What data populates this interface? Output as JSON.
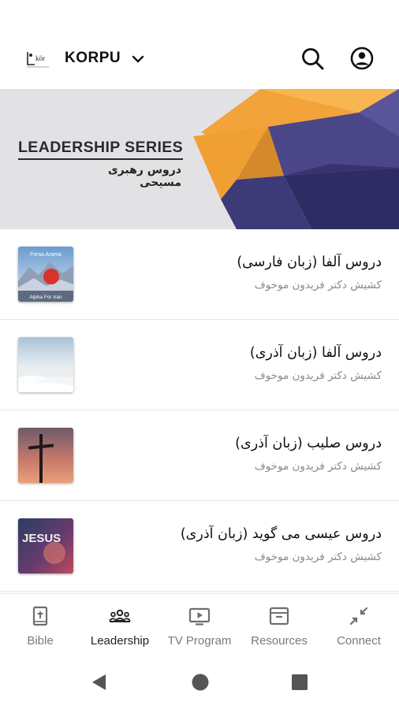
{
  "header": {
    "logo_name": "church-logo",
    "brand": "KORPU"
  },
  "banner": {
    "title": "LEADERSHIP SERIES",
    "subtitle": "دروس رهبری مسیحی",
    "colors": {
      "background": "#e2e2e4",
      "orange": "#f2a33a",
      "indigo": "#3e3a78"
    }
  },
  "lessons": [
    {
      "title": "دروس آلفا (زبان فارسی)",
      "author": "کشیش دکتر فریدون موخوف",
      "thumb_text_1": "Forsa Arama",
      "thumb_text_2": "Alpha For Iran"
    },
    {
      "title": "دروس آلفا (زبان آذری)",
      "author": "کشیش دکتر فریدون موخوف"
    },
    {
      "title": "دروس صلیب (زبان آذری)",
      "author": "کشیش دکتر فریدون موخوف"
    },
    {
      "title": "دروس عیسی می گوید (زبان آذری)",
      "author": "کشیش دکتر فریدون موخوف",
      "thumb_text_1": "JESUS"
    }
  ],
  "tabs": [
    {
      "label": "Bible",
      "icon": "bible-icon"
    },
    {
      "label": "Leadership",
      "icon": "group-icon",
      "active": true
    },
    {
      "label": "TV Program",
      "icon": "tv-icon"
    },
    {
      "label": "Resources",
      "icon": "archive-icon"
    },
    {
      "label": "Connect",
      "icon": "connect-icon"
    }
  ]
}
